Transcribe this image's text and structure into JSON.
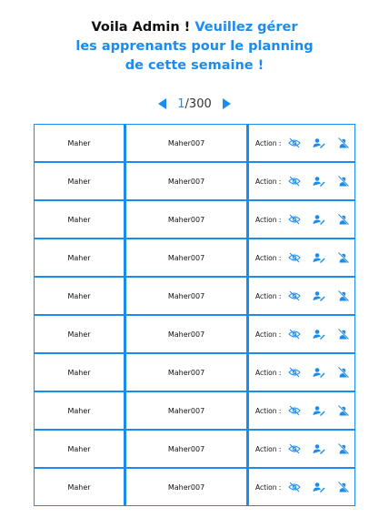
{
  "header": {
    "greeting": "Voila Admin !",
    "line1_blue": "Veuillez gérer",
    "line2": "les apprenants pour le planning",
    "line3": "de cette semaine !"
  },
  "pager": {
    "current": "1",
    "separator": "/",
    "total": "300"
  },
  "action_label": "Action :",
  "icons": [
    "eye-off-icon",
    "user-edit-icon",
    "user-remove-icon"
  ],
  "rows": [
    {
      "name": "Maher",
      "username": "Maher007"
    },
    {
      "name": "Maher",
      "username": "Maher007"
    },
    {
      "name": "Maher",
      "username": "Maher007"
    },
    {
      "name": "Maher",
      "username": "Maher007"
    },
    {
      "name": "Maher",
      "username": "Maher007"
    },
    {
      "name": "Maher",
      "username": "Maher007"
    },
    {
      "name": "Maher",
      "username": "Maher007"
    },
    {
      "name": "Maher",
      "username": "Maher007"
    },
    {
      "name": "Maher",
      "username": "Maher007"
    },
    {
      "name": "Maher",
      "username": "Maher007"
    }
  ],
  "colors": {
    "accent": "#1a8cf0"
  }
}
